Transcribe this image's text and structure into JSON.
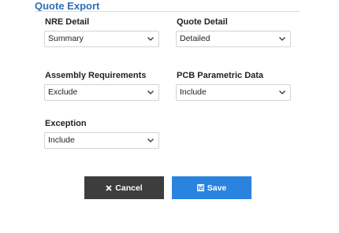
{
  "header": {
    "title": "Quote Export"
  },
  "fields": {
    "nre_detail": {
      "label": "NRE Detail",
      "value": "Summary"
    },
    "quote_detail": {
      "label": "Quote Detail",
      "value": "Detailed"
    },
    "assembly_requirements": {
      "label": "Assembly Requirements",
      "value": "Exclude"
    },
    "pcb_parametric_data": {
      "label": "PCB Parametric Data",
      "value": "Include"
    },
    "exception": {
      "label": "Exception",
      "value": "Include"
    }
  },
  "actions": {
    "cancel_label": "Cancel",
    "save_label": "Save"
  },
  "icons": {
    "dropdown": "chevron-down-icon",
    "cancel": "close-icon",
    "save": "save-icon"
  },
  "colors": {
    "title": "#2f6fb6",
    "cancel_bg": "#3d3d3d",
    "save_bg": "#2a83de"
  }
}
